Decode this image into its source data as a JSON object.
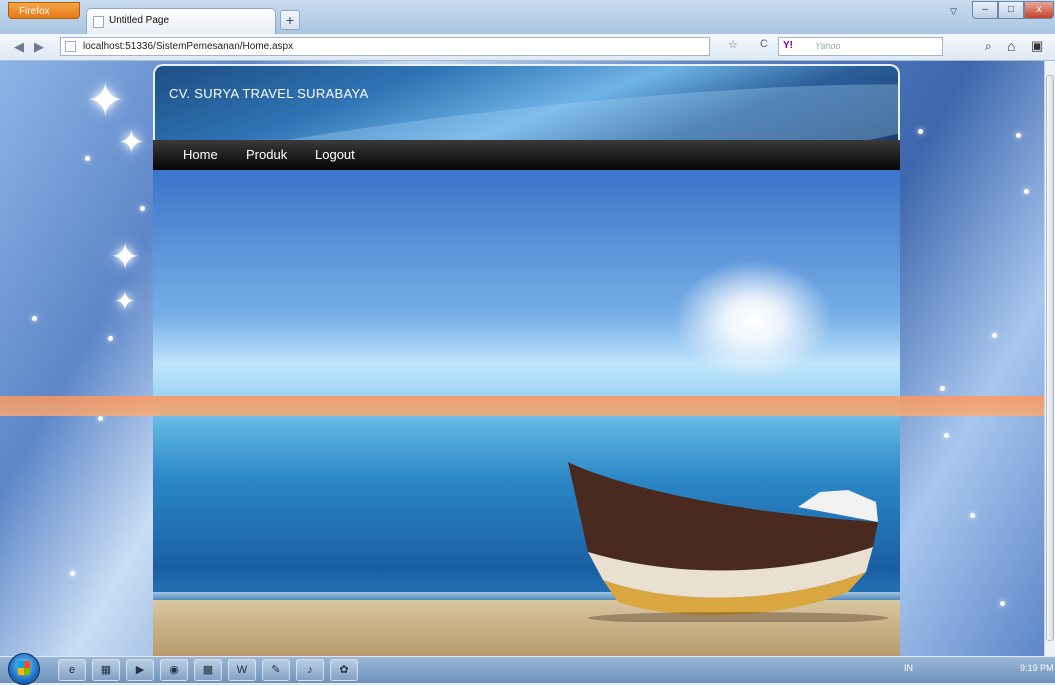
{
  "browser": {
    "menu_button": "Firefox",
    "tab_title": "Untitled Page",
    "new_tab": "+",
    "url": "localhost:51336/SistemPemesanan/Home.aspx",
    "search_engine": "Y!",
    "search_placeholder": "Yahoo",
    "back": "◀",
    "forward": "▶",
    "bookmark_star": "☆",
    "reload": "C",
    "search_go": "⌕",
    "home": "⌂",
    "addon": "▣"
  },
  "window_controls": {
    "minimize": "–",
    "maximize": "□",
    "close": "x"
  },
  "site": {
    "title": "CV. SURYA TRAVEL SURABAYA",
    "menu": [
      {
        "label": "Home"
      },
      {
        "label": "Produk"
      },
      {
        "label": "Logout"
      }
    ]
  },
  "taskbar": {
    "apps": [
      "e",
      "▦",
      "▶",
      "◉",
      "▩",
      "W",
      "✎",
      "♪",
      "✿"
    ],
    "tray": "IN",
    "clock": "9:19 PM"
  }
}
